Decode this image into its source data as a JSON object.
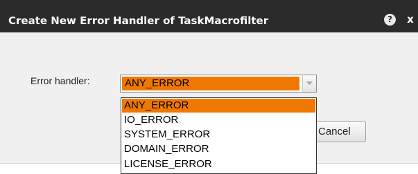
{
  "dialog": {
    "title": "Create New Error Handler of TaskMacrofilter",
    "help_glyph": "?",
    "close_glyph": "x",
    "field_label": "Error handler:",
    "selected_value": "ANY_ERROR",
    "options": [
      "ANY_ERROR",
      "IO_ERROR",
      "SYSTEM_ERROR",
      "DOMAIN_ERROR",
      "LICENSE_ERROR"
    ],
    "cancel_label": "Cancel"
  },
  "colors": {
    "titlebar": "#2b2b2b",
    "highlight": "#f07800",
    "dialog_bg": "#f0f0f0"
  },
  "icons": {
    "help": "help-icon",
    "close": "close-icon",
    "dropdown": "chevron-down-icon"
  }
}
